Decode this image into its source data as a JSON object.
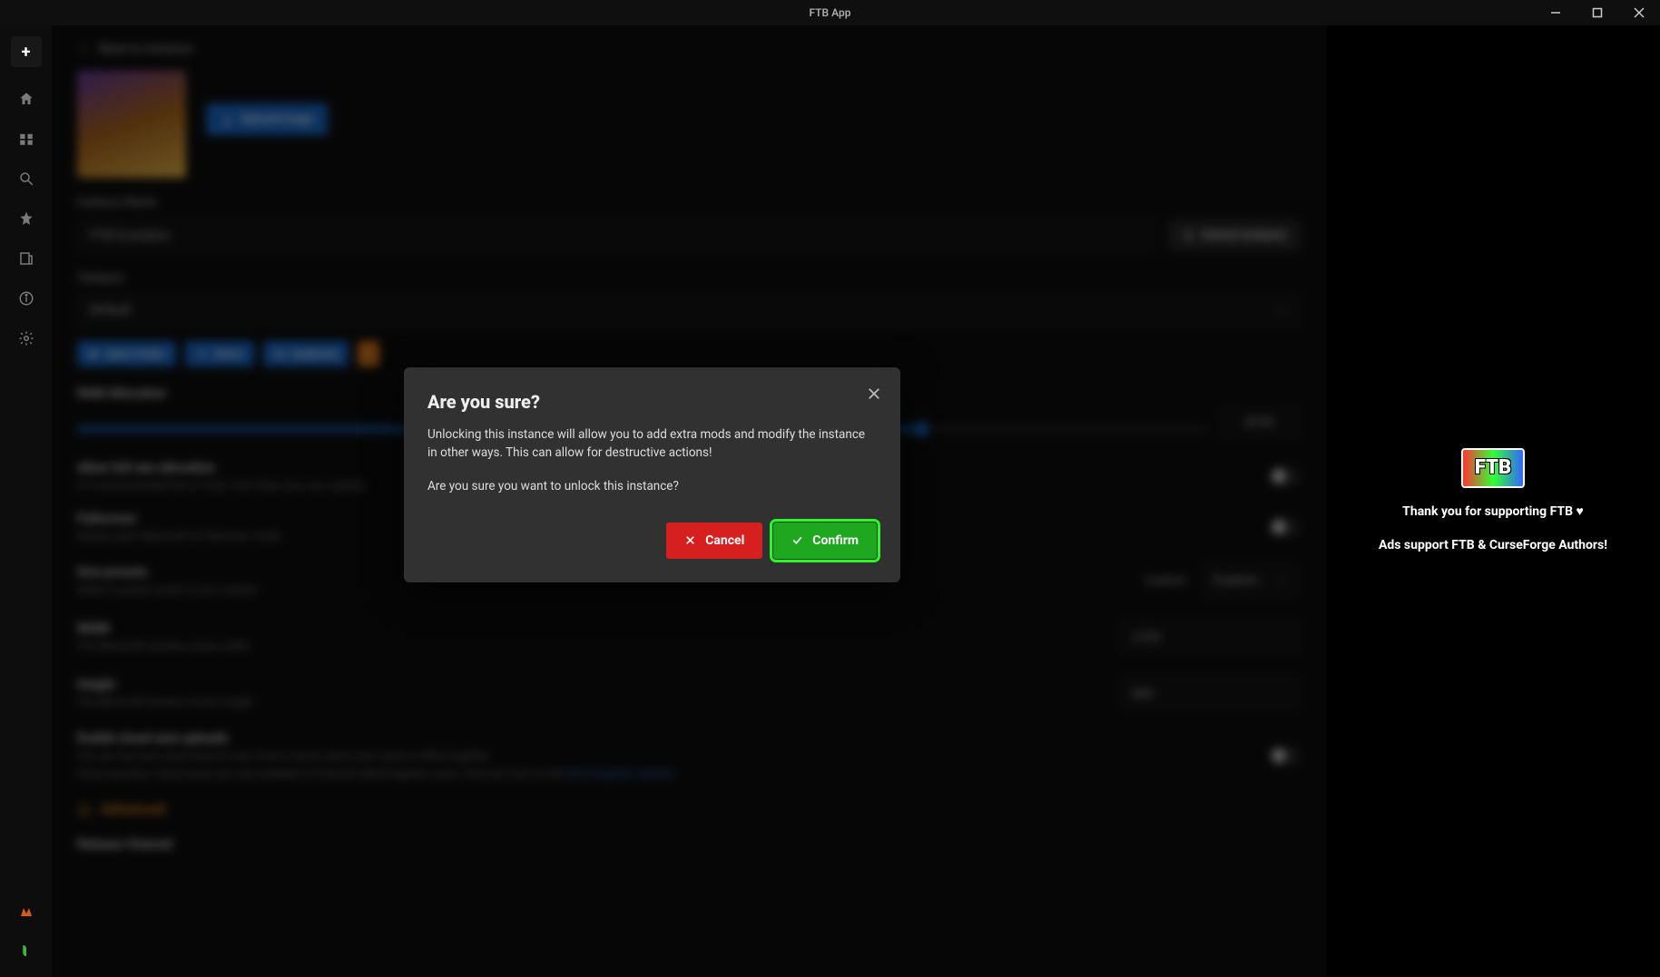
{
  "titlebar": {
    "title": "FTB App"
  },
  "back": {
    "label": "Back to instance"
  },
  "hero": {
    "upload_label": "Upload image"
  },
  "instance_name": {
    "label": "Instance Name",
    "value": "FTB Evolution"
  },
  "unlock": {
    "label": "Unlock Instance"
  },
  "category": {
    "label": "Category",
    "value": "Default"
  },
  "chips": {
    "open_folder": "Open Folder",
    "share": "Share",
    "duplicate": "Duplicate"
  },
  "ram": {
    "label": "RAM Allocation",
    "value": "8192"
  },
  "full_ram": {
    "title": "Allow full ram allocation",
    "desc": "It is recommended this is never more than your your system"
  },
  "fullscreen": {
    "title": "Fullscreen",
    "desc": "Always open Minecraft at fullscreen mode"
  },
  "size_preset": {
    "title": "Size presets",
    "desc": "Select a preset screen to your system",
    "value_label": "Custom",
    "dropdown_value": "Custom"
  },
  "width": {
    "title": "Width",
    "desc": "The Minecraft window screen width",
    "value": "1720"
  },
  "height": {
    "title": "Height",
    "desc": "The Minecraft window screen height",
    "value": "840"
  },
  "cloud_saves": {
    "title": "Enable cloud save uploads",
    "desc": "You can use your cloud saves if your mod or server syncs your saves to MineTogether",
    "warning_prefix": "Cloud syncing / Cloud saves are only available to Premium MineTogether users. Find out more on the ",
    "warning_link": "MineTogether website"
  },
  "advanced": {
    "label": "Advanced"
  },
  "release_channel": {
    "label": "Release Channel"
  },
  "promo": {
    "logo": "FTB",
    "line1": "Thank you for supporting FTB ♥",
    "line2": "Ads support FTB & CurseForge Authors!"
  },
  "modal": {
    "title": "Are you sure?",
    "body1": "Unlocking this instance will allow you to add extra mods and modify the instance in other ways. This can allow for destructive actions!",
    "body2": "Are you sure you want to unlock this instance?",
    "cancel": "Cancel",
    "confirm": "Confirm"
  }
}
